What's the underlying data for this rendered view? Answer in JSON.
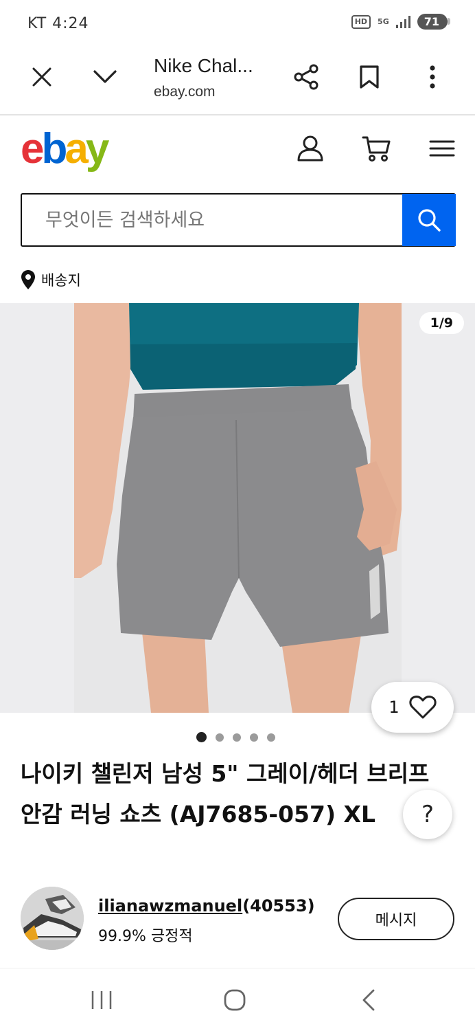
{
  "status": {
    "time": "KT 4:24",
    "hd": "HD",
    "network": "5G",
    "battery": "71"
  },
  "browser": {
    "title": "Nike Chal...",
    "domain": "ebay.com",
    "icons": [
      "close-icon",
      "chevron-down-icon",
      "share-icon",
      "bookmark-icon",
      "more-vert-icon"
    ]
  },
  "header": {
    "logo": {
      "e": "e",
      "b": "b",
      "a": "a",
      "y": "y"
    },
    "icons": [
      "account-icon",
      "cart-icon",
      "menu-icon"
    ],
    "colors": {
      "logo_e": "#e53238",
      "logo_b": "#0064d2",
      "logo_a": "#f5af02",
      "logo_y": "#86b817",
      "search_button": "#0064f0"
    }
  },
  "search": {
    "placeholder": "무엇이든 검색하세요"
  },
  "ship_to": {
    "label": "배송지"
  },
  "gallery": {
    "counter": "1/9",
    "watch_count": "1",
    "dot_count": 5,
    "active_dot": 1
  },
  "product": {
    "title": "나이키 챌린저 남성 5\" 그레이/헤더 브리프 안감 러닝 쇼츠 (AJ7685-057) XL"
  },
  "help": {
    "label": "?"
  },
  "seller": {
    "username": "ilianawzmanuel",
    "feedback": "(40553)",
    "rating": "99.9% 긍정적",
    "message_button": "메시지"
  },
  "nav": {
    "icons": [
      "recent-apps-icon",
      "home-icon",
      "back-icon"
    ]
  }
}
